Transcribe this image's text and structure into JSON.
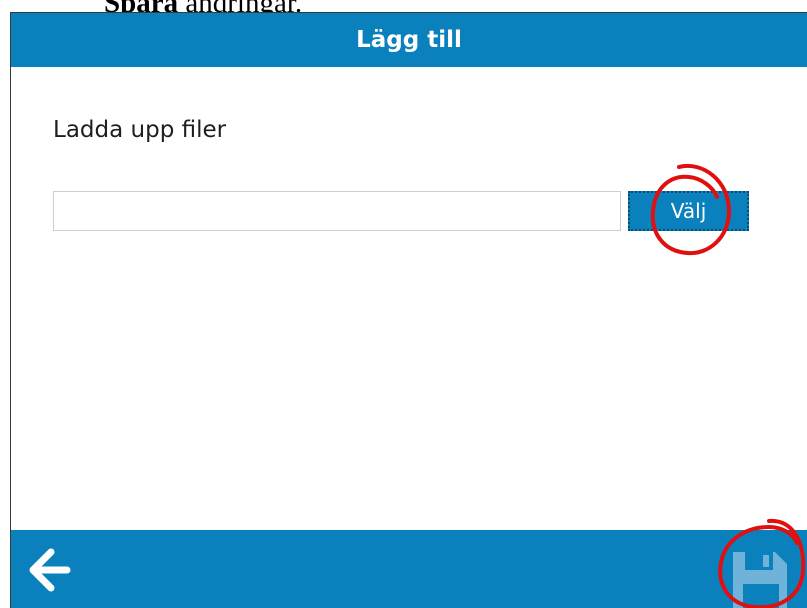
{
  "doc": {
    "bold_word": "Spara",
    "rest": " ändringar."
  },
  "dialog": {
    "title": "Lägg till",
    "upload_label": "Ladda upp filer",
    "file_input_value": "",
    "choose_button_label": "Välj"
  },
  "footer": {
    "back_icon": "arrow-left-icon",
    "save_icon": "floppy-disk-icon"
  },
  "colors": {
    "bar": "#0a80bd",
    "annotation": "#e01010"
  }
}
